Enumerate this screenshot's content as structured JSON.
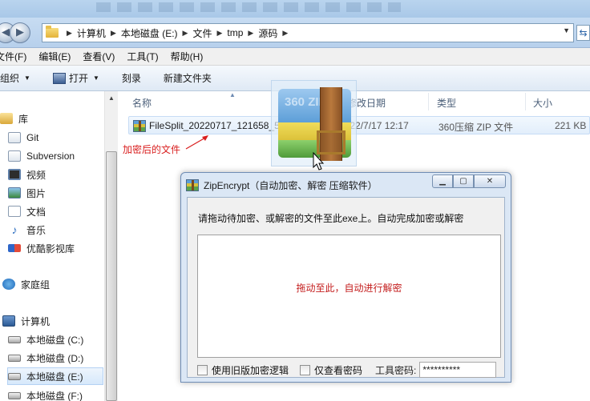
{
  "address_bar": {
    "crumbs": [
      "计算机",
      "本地磁盘 (E:)",
      "文件",
      "tmp",
      "源码"
    ]
  },
  "menu": [
    "文件(F)",
    "编辑(E)",
    "查看(V)",
    "工具(T)",
    "帮助(H)"
  ],
  "toolbar": {
    "organize": "组织",
    "open": "打开",
    "burn": "刻录",
    "new_folder": "新建文件夹"
  },
  "sidebar": {
    "library": "库",
    "items": [
      "Git",
      "Subversion",
      "视频",
      "图片",
      "文档",
      "音乐",
      "优酷影视库"
    ],
    "homegroup": "家庭组",
    "computer": "计算机",
    "drives": [
      "本地磁盘 (C:)",
      "本地磁盘 (D:)",
      "本地磁盘 (E:)",
      "本地磁盘 (F:)"
    ]
  },
  "columns": {
    "name": "名称",
    "date": "修改日期",
    "type": "类型",
    "size": "大小"
  },
  "file": {
    "name": "FileSplit_20220717_121658_577.zip",
    "date": "2022/7/17 12:17",
    "type": "360压缩 ZIP 文件",
    "size": "221 KB"
  },
  "annotation": "加密后的文件",
  "drag_icon_text": "360 ZIP",
  "dialog": {
    "title": "ZipEncrypt（自动加密、解密 压缩软件）",
    "instruction": "请拖动待加密、或解密的文件至此exe上。自动完成加密或解密",
    "drop_hint": "拖动至此，自动进行解密",
    "use_old_label": "使用旧版加密逻辑",
    "show_pwd_label": "仅查看密码",
    "tool_pwd_label": "工具密码:",
    "tool_pwd_value": "**********"
  },
  "colors": {
    "annotation": "#d91e1e",
    "drop_hint": "#c41e1e",
    "selection": "#e2eefb"
  }
}
